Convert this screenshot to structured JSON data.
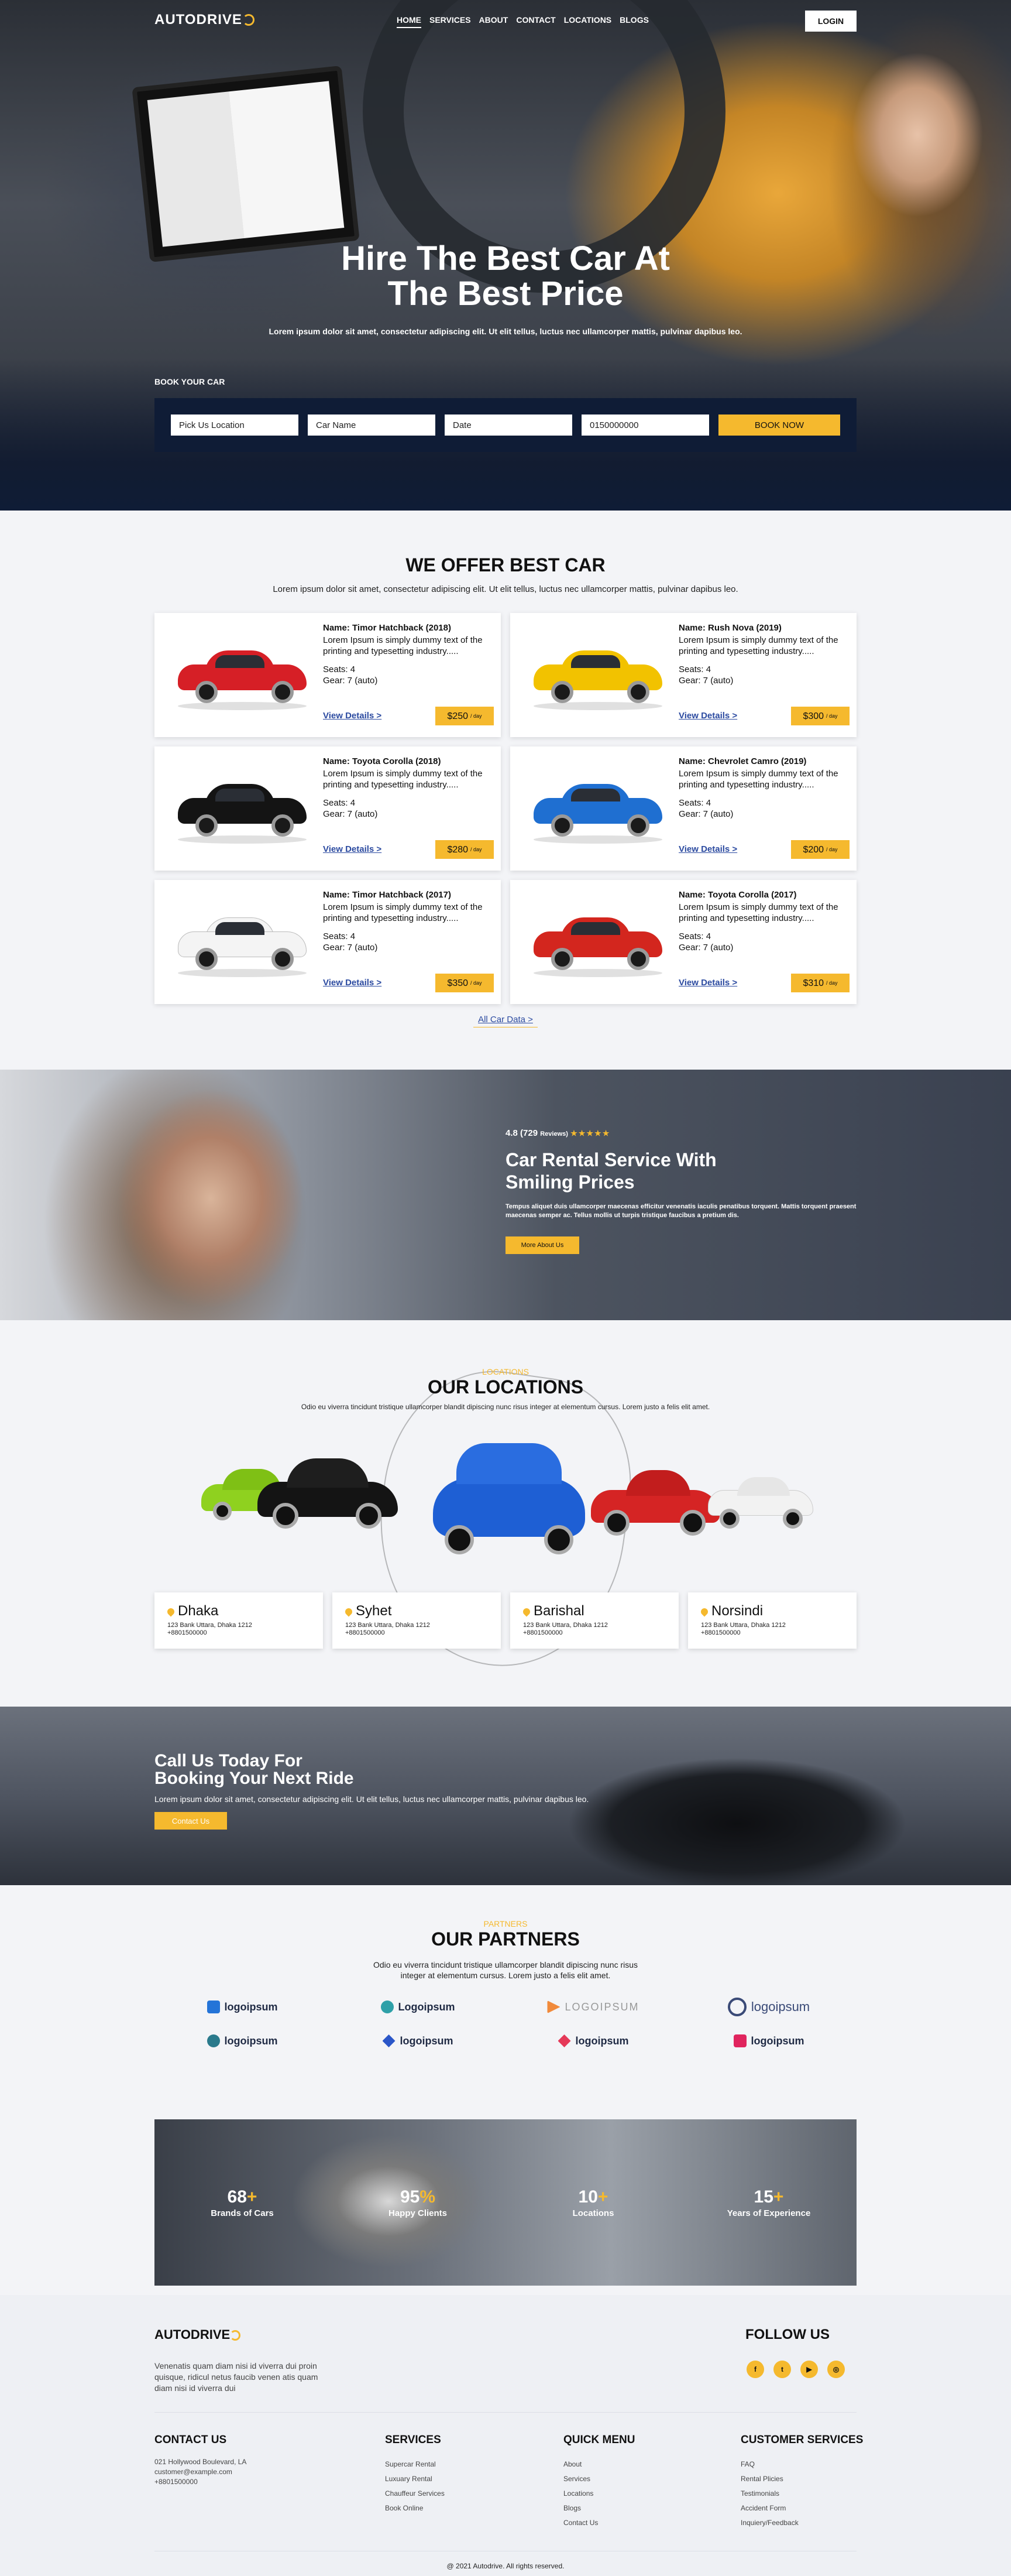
{
  "nav": {
    "logo": "AUTODRIVE",
    "items": [
      "HOME",
      "SERVICES",
      "ABOUT",
      "CONTACT",
      "LOCATIONS",
      "BLOGS"
    ],
    "login": "LOGIN"
  },
  "hero": {
    "title_line1": "Hire The Best Car At",
    "title_line2": "The Best Price",
    "subtitle": "Lorem ipsum dolor sit amet, consectetur adipiscing elit. Ut elit tellus, luctus nec ullamcorper mattis, pulvinar dapibus leo.",
    "book_label": "BOOK YOUR CAR",
    "fields": {
      "pickup": "Pick Us Location",
      "car": "Car Name",
      "date": "Date",
      "phone": "0150000000"
    },
    "book_btn": "BOOK NOW"
  },
  "offer": {
    "title": "WE OFFER BEST CAR",
    "subtitle": "Lorem ipsum dolor sit amet, consectetur adipiscing elit. Ut elit tellus, luctus nec ullamcorper mattis, pulvinar dapibus leo.",
    "cars": [
      {
        "name": "Name: Timor Hatchback (2018)",
        "desc": "Lorem Ipsum is simply dummy text of the printing and typesetting industry.....",
        "seats": "Seats: 4",
        "gear": "Gear: 7 (auto)",
        "link": "View Details >",
        "price": "$250",
        "per": "/ day",
        "color": "#d61f26"
      },
      {
        "name": "Name: Rush Nova (2019)",
        "desc": "Lorem Ipsum is simply dummy text of the printing and typesetting industry.....",
        "seats": "Seats: 4",
        "gear": "Gear: 7 (auto)",
        "link": "View Details >",
        "price": "$300",
        "per": "/ day",
        "color": "#f2c200"
      },
      {
        "name": "Name: Toyota Corolla (2018)",
        "desc": "Lorem Ipsum is simply dummy text of the printing and typesetting industry.....",
        "seats": "Seats: 4",
        "gear": "Gear: 7 (auto)",
        "link": "View Details >",
        "price": "$280",
        "per": "/ day",
        "color": "#141414"
      },
      {
        "name": "Name: Chevrolet Camro (2019)",
        "desc": "Lorem Ipsum is simply dummy text of the printing and typesetting industry.....",
        "seats": "Seats: 4",
        "gear": "Gear: 7 (auto)",
        "link": "View Details >",
        "price": "$200",
        "per": "/ day",
        "color": "#1f6fd1"
      },
      {
        "name": "Name: Timor Hatchback (2017)",
        "desc": "Lorem Ipsum is simply dummy text of the printing and typesetting industry.....",
        "seats": "Seats: 4",
        "gear": "Gear: 7 (auto)",
        "link": "View Details >",
        "price": "$350",
        "per": "/ day",
        "color": "#f4f4f4"
      },
      {
        "name": "Name: Toyota Corolla (2017)",
        "desc": "Lorem Ipsum is simply dummy text of the printing and typesetting industry.....",
        "seats": "Seats: 4",
        "gear": "Gear: 7 (auto)",
        "link": "View Details >",
        "price": "$310",
        "per": "/ day",
        "color": "#d3261e"
      }
    ],
    "all_link": "All Car Data >"
  },
  "service": {
    "rating": "4.8 (729",
    "reviews": "Reviews)",
    "stars": "★★★★★",
    "title_line1": "Car Rental Service With",
    "title_line2": "Smiling Prices",
    "text": "Tempus aliquet duis ullamcorper maecenas efficitur venenatis iaculis penatibus torquent. Mattis torquent praesent maecenas semper ac. Tellus mollis ut turpis tristique faucibus a pretium dis.",
    "button": "More About Us"
  },
  "locations": {
    "kicker": "LOCATIONS",
    "title": "OUR LOCATIONS",
    "subtitle": "Odio eu viverra tincidunt tristique ullamcorper blandit dipiscing nunc risus integer at elementum cursus. Lorem justo a felis elit amet.",
    "items": [
      {
        "city": "Dhaka",
        "addr": "123 Bank Uttara, Dhaka 1212",
        "phone": "+8801500000"
      },
      {
        "city": "Syhet",
        "addr": "123 Bank Uttara, Dhaka 1212",
        "phone": "+8801500000"
      },
      {
        "city": "Barishal",
        "addr": "123 Bank Uttara, Dhaka 1212",
        "phone": "+8801500000"
      },
      {
        "city": "Norsindi",
        "addr": "123 Bank Uttara, Dhaka 1212",
        "phone": "+8801500000"
      }
    ]
  },
  "call": {
    "title_line1": "Call Us Today For",
    "title_line2": "Booking Your Next Ride",
    "text": "Lorem ipsum dolor sit amet, consectetur adipiscing elit. Ut elit tellus, luctus nec ullamcorper mattis, pulvinar dapibus leo.",
    "button": "Contact Us"
  },
  "partners": {
    "kicker": "PARTNERS",
    "title": "OUR PARTNERS",
    "subtitle_line1": "Odio eu viverra tincidunt tristique ullamcorper blandit dipiscing nunc risus",
    "subtitle_line2": "integer at elementum cursus. Lorem justo a felis elit amet.",
    "logos": [
      "logoipsum",
      "Logoipsum",
      "LOGOIPSUM",
      "logoipsum",
      "logoipsum",
      "logoipsum",
      "logoipsum",
      "logoipsum"
    ]
  },
  "stats": [
    {
      "num": "68",
      "plus": "+",
      "label": "Brands of Cars"
    },
    {
      "num": "95",
      "plus": "%",
      "label": "Happy Clients"
    },
    {
      "num": "10",
      "plus": "+",
      "label": "Locations"
    },
    {
      "num": "15",
      "plus": "+",
      "label": "Years of Experience"
    }
  ],
  "footer": {
    "logo": "AUTODRIVE",
    "desc": "Venenatis quam diam nisi id viverra dui proin quisque, ridicul netus faucib venen atis quam diam nisi id viverra dui",
    "follow": "FOLLOW US",
    "contact_title": "CONTACT US",
    "contact": [
      "021 Hollywood Boulevard, LA",
      "customer@example.com",
      "+8801500000"
    ],
    "services_title": "SERVICES",
    "services": [
      "Supercar Rental",
      "Luxuary Rental",
      "Chauffeur Services",
      "Book Online"
    ],
    "quick_title": "QUICK MENU",
    "quick": [
      "About",
      "Services",
      "Locations",
      "Blogs",
      "Contact Us"
    ],
    "customer_title": "CUSTOMER SERVICES",
    "customer": [
      "FAQ",
      "Rental Plicies",
      "Testimonials",
      "Accident Form",
      "Inquiery/Feedback"
    ],
    "copyright": "@ 2021 Autodrive. All rights reserved."
  }
}
